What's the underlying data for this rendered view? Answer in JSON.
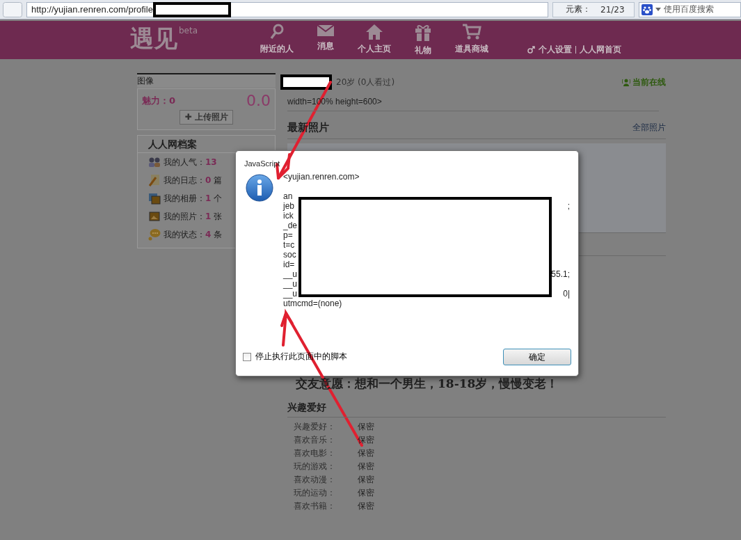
{
  "browser": {
    "url": "http://yujian.renren.com/profile",
    "counter_label": "元素：",
    "counter": "21/23",
    "search_placeholder": "使用百度搜索"
  },
  "header": {
    "logo": "遇见",
    "logo_badge": "beta",
    "nav": [
      {
        "label": "附近的人",
        "kind": "search"
      },
      {
        "label": "消息",
        "kind": "mail"
      },
      {
        "label": "个人主页",
        "kind": "home"
      },
      {
        "label": "礼物",
        "kind": "gift"
      },
      {
        "label": "道具商城",
        "kind": "cart"
      }
    ],
    "links": [
      "个人设置",
      "人人网首页"
    ]
  },
  "sidebar": {
    "avatar_title": "图像",
    "charm_label": "魅力：",
    "charm_value": "0",
    "score": "0.0",
    "upload_icon": "✚",
    "upload_button": "上传照片",
    "profile_title": "人人网档案",
    "stats": [
      {
        "kind": "people",
        "label": "我的人气：",
        "value": "13"
      },
      {
        "kind": "blog",
        "label": "我的日志：",
        "value": "0",
        "unit": "篇"
      },
      {
        "kind": "album",
        "label": "我的相册：",
        "value": "1",
        "unit": "个"
      },
      {
        "kind": "photo",
        "label": "我的照片：",
        "value": "1",
        "unit": "张"
      },
      {
        "kind": "status",
        "label": "我的状态：",
        "value": "4",
        "unit": "条"
      }
    ]
  },
  "profile": {
    "age": "20岁 (0人看过)",
    "online": "当前在线",
    "code_line": "width=100% height=600>",
    "photos_title": "最新照片",
    "photos_link": "全部照片",
    "wish": "交友意愿：想和一个男生，18-18岁，慢慢变老！",
    "interests_title": "兴趣爱好",
    "interests": [
      {
        "label": "兴趣爱好：",
        "value": "保密"
      },
      {
        "label": "喜欢音乐：",
        "value": "保密"
      },
      {
        "label": "喜欢电影：",
        "value": "保密"
      },
      {
        "label": "玩的游戏：",
        "value": "保密"
      },
      {
        "label": "喜欢动漫：",
        "value": "保密"
      },
      {
        "label": "玩的运动：",
        "value": "保密"
      },
      {
        "label": "喜欢书籍：",
        "value": "保密"
      }
    ]
  },
  "dialog": {
    "title": "JavaScript",
    "origin": "<yujian.renren.com>",
    "lines": [
      {
        "start": "an"
      },
      {
        "start": "jeb",
        "end": ";"
      },
      {
        "start": "ick"
      },
      {
        "start": "_de"
      },
      {
        "start": "p="
      },
      {
        "start": "t=c"
      },
      {
        "start": "soc"
      },
      {
        "start": "id="
      },
      {
        "start": "__u",
        "end": "55.1;"
      },
      {
        "start": "__u"
      },
      {
        "start": "__u",
        "end": "0|"
      }
    ],
    "last_line": "utmcmd=(none)",
    "checkbox": {
      "label": "停止执行此页面中的脚本",
      "checked": false
    },
    "button": "确定"
  }
}
